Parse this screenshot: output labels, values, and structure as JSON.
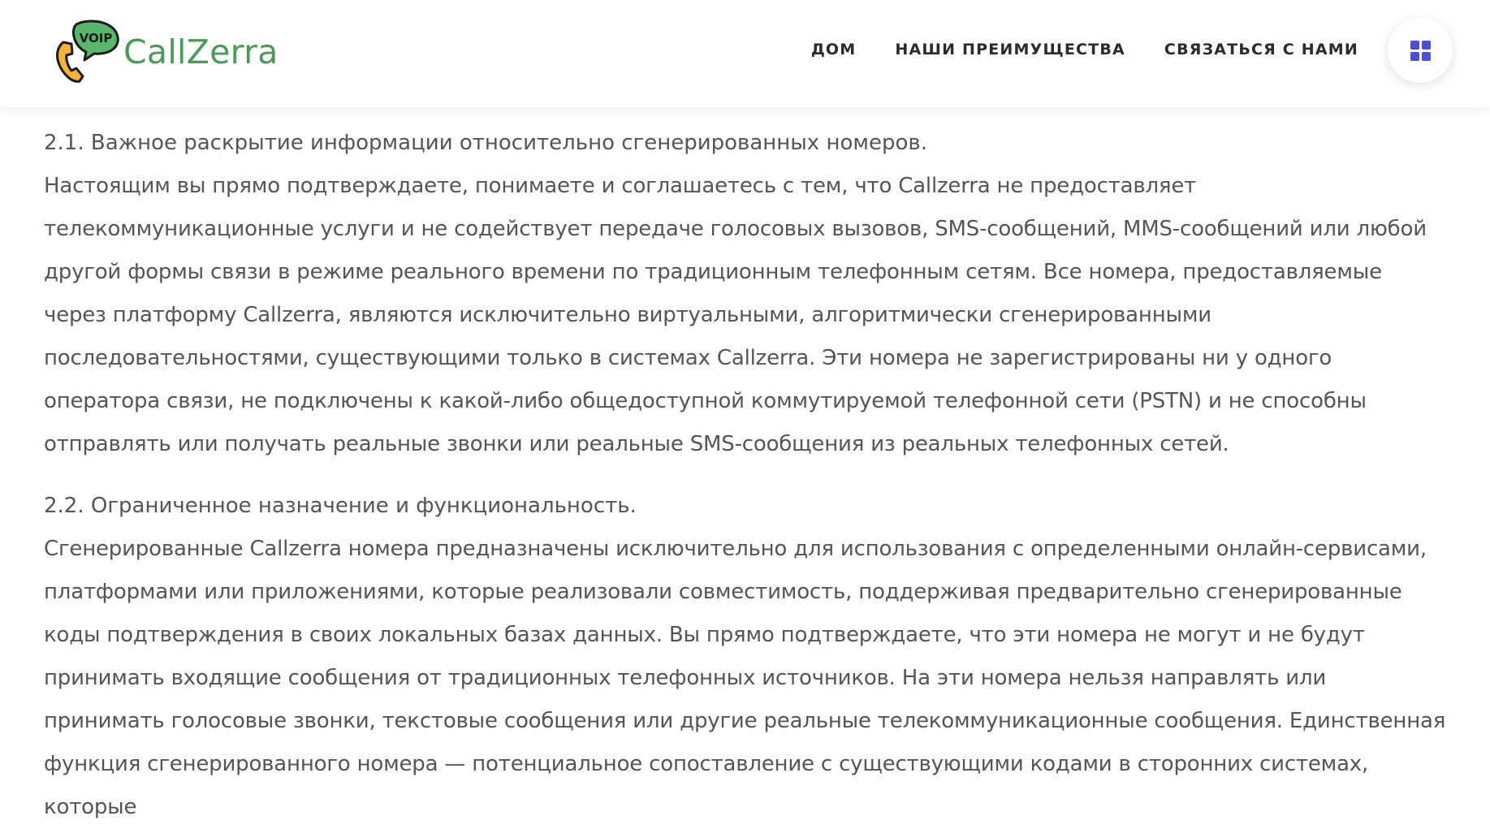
{
  "brand": {
    "name": "CallZerra",
    "badge": "VOIP",
    "color": "#4b9a5a"
  },
  "nav": {
    "items": [
      {
        "label": "ДОМ"
      },
      {
        "label": "НАШИ ПРЕИМУЩЕСТВА"
      },
      {
        "label": "СВЯЗАТЬСЯ С НАМИ"
      }
    ],
    "menu_icon": "grid-icon",
    "accent": "#4a4fd8"
  },
  "sections": [
    {
      "heading": "2.1. Важное раскрытие информации относительно сгенерированных номеров.",
      "body": "Настоящим вы прямо подтверждаете, понимаете и соглашаетесь с тем, что Callzerra не предоставляет телекоммуникационные услуги и не содействует передаче голосовых вызовов, SMS-сообщений, MMS-сообщений или любой другой формы связи в режиме реального времени по традиционным телефонным сетям. Все номера, предоставляемые через платформу Callzerra, являются исключительно виртуальными, алгоритмически сгенерированными последовательностями, существующими только в системах Callzerra. Эти номера не зарегистрированы ни у одного оператора связи, не подключены к какой-либо общедоступной коммутируемой телефонной сети (PSTN) и не способны отправлять или получать реальные звонки или реальные SMS-сообщения из реальных телефонных сетей."
    },
    {
      "heading": "2.2. Ограниченное назначение и функциональность.",
      "body": "Сгенерированные Callzerra номера предназначены исключительно для использования с определенными онлайн-сервисами, платформами или приложениями, которые реализовали совместимость, поддерживая предварительно сгенерированные коды подтверждения в своих локальных базах данных. Вы прямо подтверждаете, что эти номера не могут и не будут принимать входящие сообщения от традиционных телефонных источников. На эти номера нельзя направлять или принимать голосовые звонки, текстовые сообщения или другие реальные телекоммуникационные сообщения. Единственная функция сгенерированного номера — потенциальное сопоставление с существующими кодами в сторонних системах, которые"
    }
  ]
}
